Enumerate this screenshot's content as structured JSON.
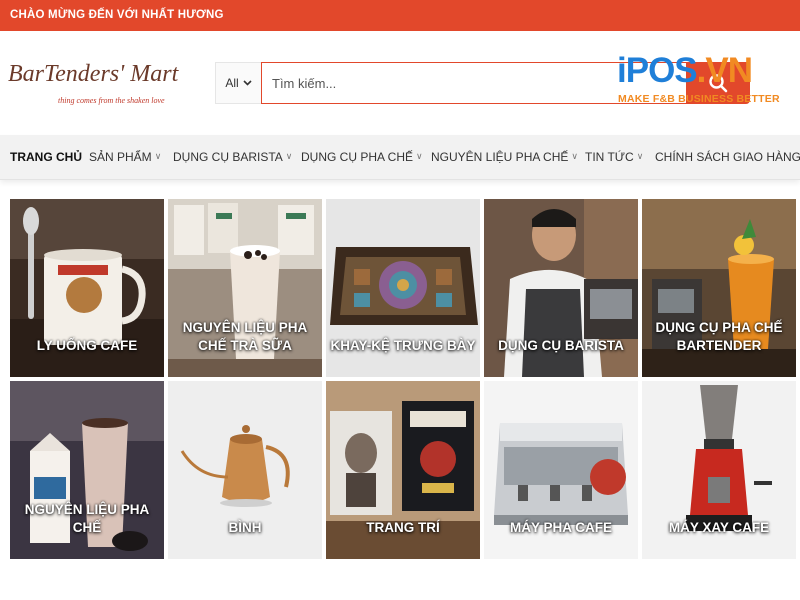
{
  "topbar": {
    "welcome": "CHÀO MỪNG ĐẾN VỚI NHẤT HƯƠNG",
    "color": "#e2482b"
  },
  "logo": {
    "wordmark": "BarTenders' Mart",
    "tagline": "thing comes from the shaken love"
  },
  "search": {
    "category": "All",
    "placeholder": "Tìm kiếm...",
    "button_icon": "search-icon"
  },
  "watermark": {
    "brand_main": "iPOS",
    "brand_suffix": ".VN",
    "slogan": "MAKE F&B BUSINESS BETTER"
  },
  "nav": {
    "items": [
      {
        "label": "TRANG CHỦ"
      },
      {
        "label": "SẢN PHẨM"
      },
      {
        "label": "DỤNG CỤ BARISTA"
      },
      {
        "label": "DỤNG CỤ PHA CHẾ"
      },
      {
        "label": "NGUYÊN LIỆU PHA CHẾ"
      },
      {
        "label": "TIN TỨC"
      },
      {
        "label": "CHÍNH SÁCH GIAO HÀNG"
      }
    ]
  },
  "categories": [
    {
      "label": "LY UỐNG CAFE"
    },
    {
      "label": "NGUYÊN LIỆU PHA CHẾ TRÀ SỮA"
    },
    {
      "label": "KHAY-KỆ TRƯNG BÀY"
    },
    {
      "label": "DỤNG CỤ BARISTA"
    },
    {
      "label": "DỤNG CỤ PHA CHẾ BARTENDER"
    },
    {
      "label": "NGUYÊN LIỆU PHA CHẾ"
    },
    {
      "label": "BÌNH"
    },
    {
      "label": "TRANG TRÍ"
    },
    {
      "label": "MÁY PHA CAFE"
    },
    {
      "label": "MÁY XAY CAFE"
    }
  ]
}
